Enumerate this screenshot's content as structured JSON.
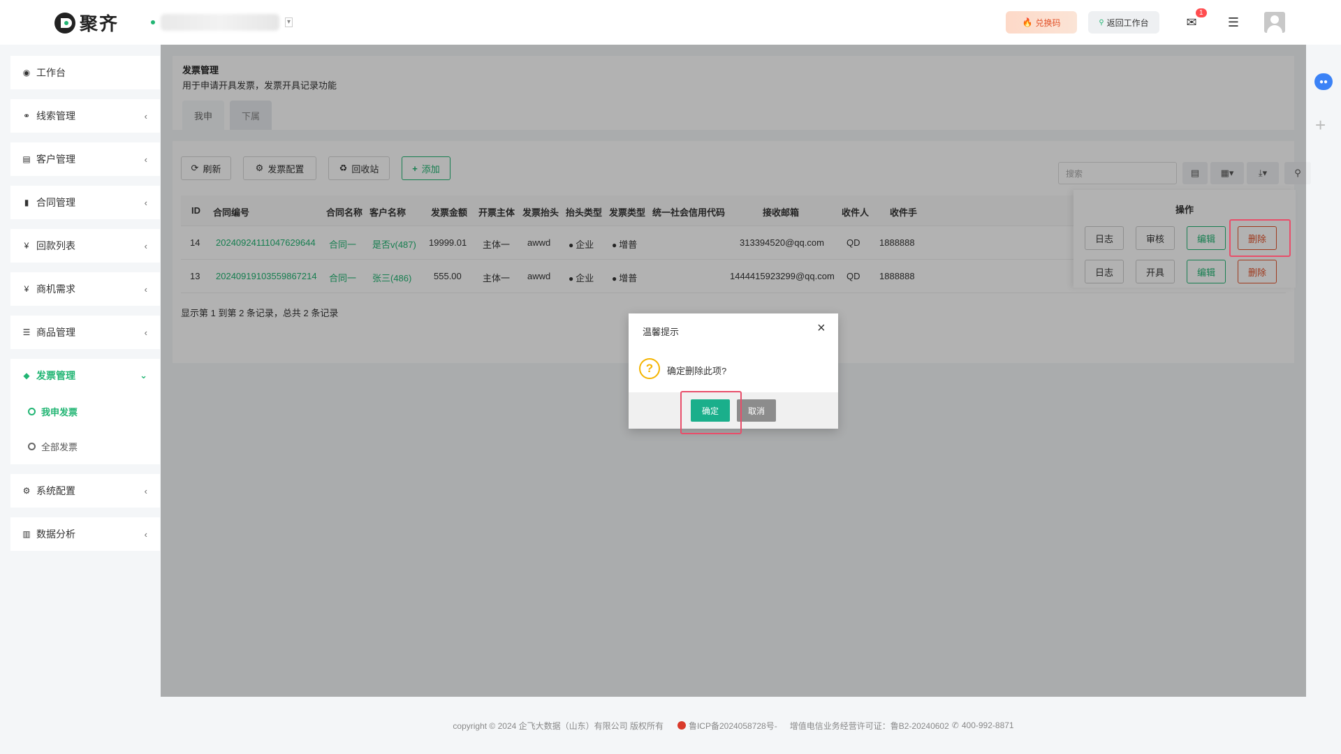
{
  "header": {
    "logo_text": "聚齐",
    "redeem_label": "兑换码",
    "back_label": "返回工作台",
    "mail_badge": "1",
    "icons": {
      "redeem": "fire-icon",
      "back": "search-icon",
      "mail": "mail-icon",
      "menu": "menu-icon",
      "tenant": "caret-down-icon"
    }
  },
  "sidebar": {
    "items": [
      {
        "label": "工作台",
        "icon": "dashboard-icon"
      },
      {
        "label": "线索管理",
        "icon": "link-icon"
      },
      {
        "label": "客户管理",
        "icon": "id-card-icon"
      },
      {
        "label": "合同管理",
        "icon": "bookmark-icon"
      },
      {
        "label": "回款列表",
        "icon": "yen-icon"
      },
      {
        "label": "商机需求",
        "icon": "yen-icon"
      },
      {
        "label": "商品管理",
        "icon": "list-icon"
      },
      {
        "label": "发票管理",
        "icon": "ticket-icon"
      },
      {
        "label": "系统配置",
        "icon": "gears-icon"
      },
      {
        "label": "数据分析",
        "icon": "bar-chart-icon"
      }
    ],
    "sub_items": [
      {
        "label": "我申发票"
      },
      {
        "label": "全部发票"
      }
    ]
  },
  "page": {
    "title": "发票管理",
    "description": "用于申请开具发票，发票开具记录功能",
    "tabs": [
      "我申",
      "下属"
    ]
  },
  "toolbar": {
    "refresh_label": "刷新",
    "config_label": "发票配置",
    "bin_label": "回收站",
    "add_label": "添加",
    "search_placeholder": "搜索"
  },
  "table": {
    "headers": [
      "ID",
      "合同编号",
      "合同名称",
      "客户名称",
      "发票金额",
      "开票主体",
      "发票抬头",
      "抬头类型",
      "发票类型",
      "统一社会信用代码",
      "接收邮箱",
      "收件人",
      "收件手",
      "操作"
    ],
    "rows": [
      {
        "id": "14",
        "contract_no": "20240924111047629644",
        "contract_name": "合同一",
        "customer": "是否v(487)",
        "amount": "19999.01",
        "entity": "主体一",
        "title": "awwd",
        "title_type": "企业",
        "invoice_type": "增普",
        "credit_code": "",
        "email": "313394520@qq.com",
        "receiver": "QD",
        "phone": "1888888",
        "ops": [
          "日志",
          "审核",
          "编辑",
          "删除"
        ]
      },
      {
        "id": "13",
        "contract_no": "20240919103559867214",
        "contract_name": "合同一",
        "customer": "张三(486)",
        "amount": "555.00",
        "entity": "主体一",
        "title": "awwd",
        "title_type": "企业",
        "invoice_type": "增普",
        "credit_code": "",
        "email": "1444415923299@qq.com",
        "receiver": "QD",
        "phone": "1888888",
        "ops": [
          "日志",
          "开具",
          "编辑",
          "删除"
        ]
      }
    ],
    "summary": "显示第 1 到第 2 条记录，总共 2 条记录"
  },
  "dialog": {
    "title": "温馨提示",
    "message": "确定删除此项?",
    "ok_label": "确定",
    "cancel_label": "取消"
  },
  "footer": {
    "copyright": "copyright © 2024 企飞大数据（山东）有限公司 版权所有",
    "icp": "鲁ICP备2024058728号-",
    "license": "增值电信业务经营许可证：鲁B2-20240602",
    "phone": "400-992-8871"
  },
  "colors": {
    "accent": "#21b573",
    "danger": "#e2522a",
    "highlight": "#e84e6a"
  }
}
